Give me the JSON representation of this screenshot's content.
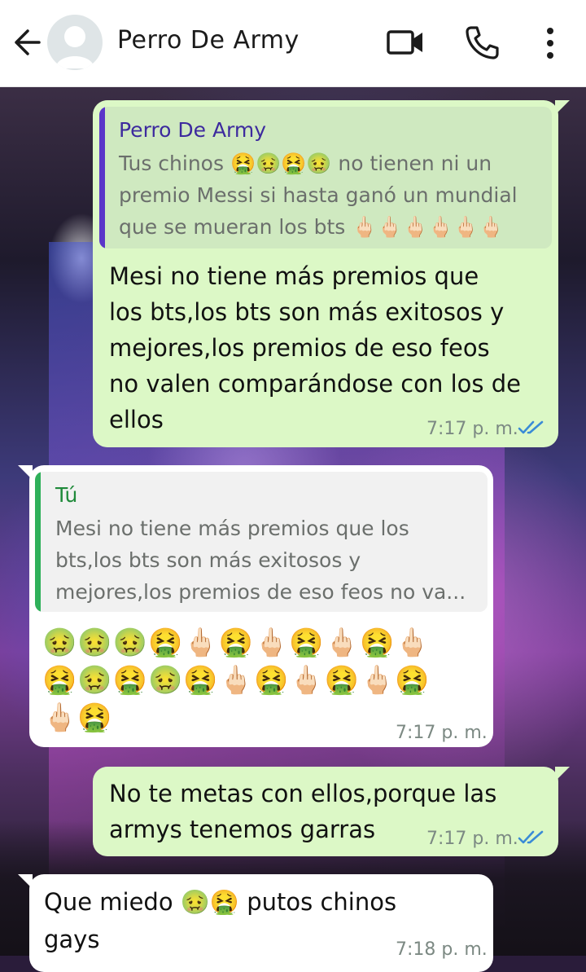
{
  "header": {
    "contact_name": "Perro De Army"
  },
  "icons": {
    "back": "arrow-left-icon",
    "avatar": "default-avatar-icon",
    "video": "video-camera-icon",
    "phone": "phone-icon",
    "menu": "more-vertical-icon"
  },
  "colors": {
    "outgoing_bubble": "#dcf8c6",
    "incoming_bubble": "#ffffff",
    "quote_contact_accent": "#5a35c9",
    "quote_self_accent": "#2fb05a",
    "read_ticks": "#3a8bd6"
  },
  "messages": [
    {
      "direction": "outgoing",
      "quote": {
        "author": "Perro De Army",
        "lines": [
          "Tus chinos 🤮🤢🤮🤢 no tienen ni un",
          "premio Messi si hasta ganó un mundial",
          "que se mueran los bts 🖕🏻🖕🏻🖕🏻🖕🏻🖕🏻🖕🏻"
        ]
      },
      "lines": [
        "Mesi no tiene más premios que",
        "los bts,los bts son más exitosos y",
        "mejores,los premios de eso feos",
        "no valen comparándose con los de",
        "ellos"
      ],
      "time": "7:17 p. m.",
      "status": "read"
    },
    {
      "direction": "incoming",
      "quote": {
        "author": "Tú",
        "lines": [
          "Mesi no tiene más premios que los",
          "bts,los bts son más exitosos y",
          "mejores,los premios de eso feos no va..."
        ]
      },
      "lines": [
        "🤢🤢🤢🤮🖕🏻🤮🖕🏻🤮🖕🏻🤮🖕🏻",
        "🤮🤢🤮🤢🤮🖕🏻🤮🖕🏻🤮🖕🏻🤮",
        "🖕🏻🤮"
      ],
      "time": "7:17 p. m."
    },
    {
      "direction": "outgoing",
      "lines": [
        "No te metas con ellos,porque las",
        "armys tenemos garras"
      ],
      "time": "7:17 p. m.",
      "status": "read"
    },
    {
      "direction": "incoming",
      "lines": [
        "Que miedo 🤢🤮 putos chinos",
        "gays"
      ],
      "time": "7:18 p. m."
    }
  ]
}
